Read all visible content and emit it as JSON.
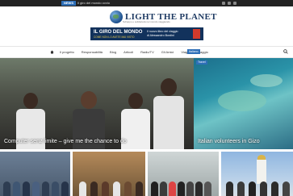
{
  "topbar": {
    "badge": "NEWS",
    "ticker": "Il giro del mondo ovvio"
  },
  "logo": {
    "title": "LIGHT THE PLANET",
    "subtitle": "Sviluppo e solidarietà nel mondo viaggiando"
  },
  "banner": {
    "title": "IL GIRO DEL MONDO",
    "subtitle": "COME NON LO AVETE MAI VISTO",
    "text_line1": "Il nuovo libro del viaggio",
    "text_line2": "di Alessandro Bordini"
  },
  "nav": {
    "items": [
      "Il progetto",
      "Responsabilità",
      "Blog",
      "Articoli",
      "Radio/TV",
      "Gli Amici",
      "Viaggio del viaggio"
    ],
    "language": "Italiano"
  },
  "features": [
    {
      "tag": "",
      "caption": "Computer senz limite – give me the chance to do",
      "tag_color": "#c0392b"
    },
    {
      "tag": "Travel",
      "caption": "Italian volunteers in Gizo",
      "tag_color": "#2e6fb8"
    }
  ],
  "colors": {
    "accent": "#2e6fb8",
    "tag_red": "#c0392b",
    "banner_bg": "#12325c"
  }
}
